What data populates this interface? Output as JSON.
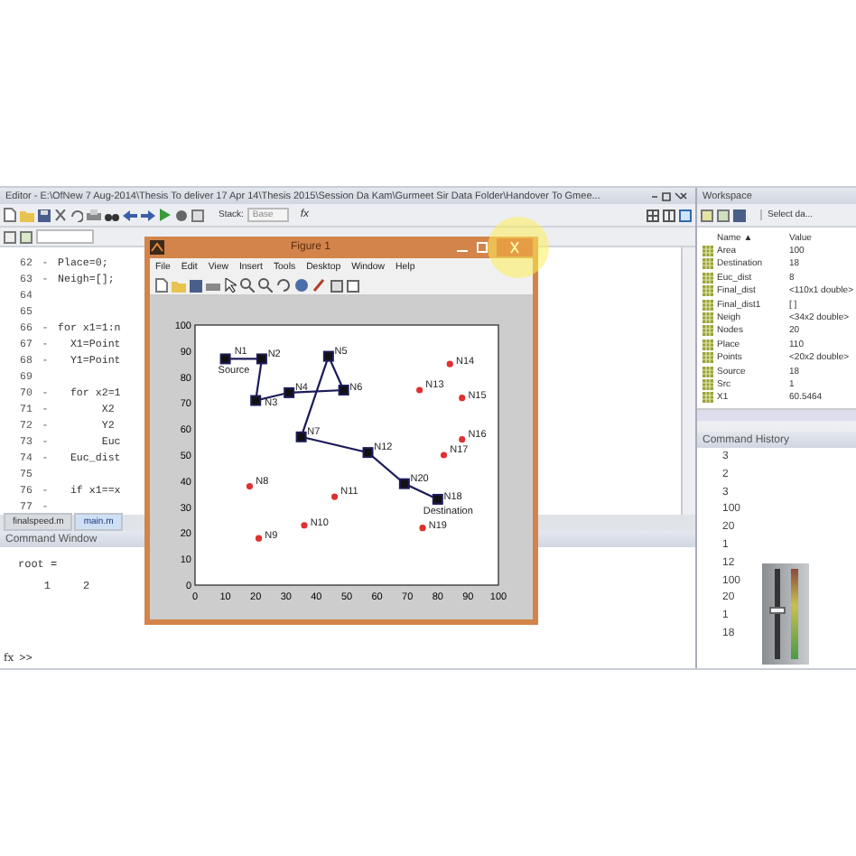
{
  "editor": {
    "title": "Editor - E:\\OfNew 7 Aug-2014\\Thesis To deliver 17 Apr 14\\Thesis 2015\\Session Da Kam\\Gurmeet Sir Data Folder\\Handover To Gmee...",
    "stack_label": "Stack:",
    "stack_value": "Base",
    "fx": "fx",
    "lines": [
      {
        "number": "62",
        "marker": "-",
        "code": "Place=0;"
      },
      {
        "number": "63",
        "marker": "-",
        "code": "Neigh=[];"
      },
      {
        "number": "64"
      },
      {
        "number": "65"
      },
      {
        "number": "66",
        "marker": "-",
        "code": "for x1=1:n"
      },
      {
        "number": "67",
        "marker": "-",
        "code": "  X1=Point"
      },
      {
        "number": "68",
        "marker": "-",
        "code": "  Y1=Point"
      },
      {
        "number": "69"
      },
      {
        "number": "70",
        "marker": "-",
        "code": "  for x2=1"
      },
      {
        "number": "71",
        "marker": "-",
        "code": "       X2"
      },
      {
        "number": "72",
        "marker": "-",
        "code": "       Y2"
      },
      {
        "number": "73",
        "marker": "-",
        "code": "       Euc"
      },
      {
        "number": "74",
        "marker": "-",
        "code": "  Euc_dist"
      },
      {
        "number": "75"
      },
      {
        "number": "76",
        "marker": "-",
        "code": "  if x1==x"
      },
      {
        "number": "77",
        "marker": "-"
      }
    ],
    "tabs": [
      {
        "label": "finalspeed.m",
        "selected": false
      },
      {
        "label": "main.m",
        "selected": true
      }
    ]
  },
  "command_window": {
    "title": "Command Window",
    "lines": [
      "root =",
      "    1     2"
    ],
    "function_label": "fx",
    "prompt": ">>"
  },
  "figure": {
    "title": "Figure 1",
    "menu": [
      "File",
      "Edit",
      "View",
      "Insert",
      "Tools",
      "Desktop",
      "Window",
      "Help"
    ],
    "chart_data": {
      "type": "line",
      "xlim": [
        0,
        100
      ],
      "ylim": [
        0,
        100
      ],
      "xticks": [
        0,
        10,
        20,
        30,
        40,
        50,
        60,
        70,
        80,
        90,
        100
      ],
      "yticks": [
        0,
        10,
        20,
        30,
        40,
        50,
        60,
        70,
        80,
        90,
        100
      ],
      "series": [
        {
          "type": "line",
          "marker": "square",
          "color": "#1c1c5a",
          "x": [
            10,
            22,
            20,
            31,
            49,
            44,
            35,
            57,
            69,
            80
          ],
          "values": [
            87,
            87,
            71,
            74,
            75,
            88,
            57,
            51,
            39,
            33
          ]
        },
        {
          "type": "scatter",
          "color": "#e03030",
          "x": [
            18,
            21,
            36,
            46,
            74,
            84,
            88,
            88,
            82,
            75
          ],
          "values": [
            38,
            18,
            23,
            34,
            75,
            85,
            72,
            56,
            50,
            22
          ]
        }
      ],
      "annotations": [
        {
          "x": 13,
          "y": 89,
          "text": "N1"
        },
        {
          "x": 24,
          "y": 88,
          "text": "N2"
        },
        {
          "x": 23,
          "y": 69,
          "text": "N3"
        },
        {
          "x": 33,
          "y": 75,
          "text": "N4"
        },
        {
          "x": 46,
          "y": 89,
          "text": "N5"
        },
        {
          "x": 51,
          "y": 75,
          "text": "N6"
        },
        {
          "x": 37,
          "y": 58,
          "text": "N7"
        },
        {
          "x": 20,
          "y": 39,
          "text": "N8"
        },
        {
          "x": 23,
          "y": 18,
          "text": "N9"
        },
        {
          "x": 38,
          "y": 23,
          "text": "N10"
        },
        {
          "x": 48,
          "y": 35,
          "text": "N11"
        },
        {
          "x": 59,
          "y": 52,
          "text": "N12"
        },
        {
          "x": 76,
          "y": 76,
          "text": "N13"
        },
        {
          "x": 86,
          "y": 85,
          "text": "N14"
        },
        {
          "x": 90,
          "y": 72,
          "text": "N15"
        },
        {
          "x": 90,
          "y": 57,
          "text": "N16"
        },
        {
          "x": 84,
          "y": 51,
          "text": "N17"
        },
        {
          "x": 82,
          "y": 33,
          "text": "N18"
        },
        {
          "x": 77,
          "y": 22,
          "text": "N19"
        },
        {
          "x": 71,
          "y": 40,
          "text": "N20"
        },
        "Source",
        "Destination"
      ]
    }
  },
  "workspace": {
    "title": "Workspace",
    "select": "Select da...",
    "columns": [
      "Name ▲",
      "Value"
    ],
    "rows": [
      {
        "name": "Area",
        "value": "100"
      },
      {
        "name": "Destination",
        "value": "18"
      },
      {
        "name": "Euc_dist",
        "value": "8"
      },
      {
        "name": "Final_dist",
        "value": "<110x1 double>"
      },
      {
        "name": "Final_dist1",
        "value": "[ ]"
      },
      {
        "name": "Neigh",
        "value": "<34x2 double>"
      },
      {
        "name": "Nodes",
        "value": "20"
      },
      {
        "name": "Place",
        "value": "110"
      },
      {
        "name": "Points",
        "value": "<20x2 double>"
      },
      {
        "name": "Source",
        "value": "18"
      },
      {
        "name": "Src",
        "value": "1"
      },
      {
        "name": "X1",
        "value": "60.5464"
      }
    ]
  },
  "command_history": {
    "title": "Command History",
    "entries": [
      "3",
      "2",
      "3",
      "100",
      "20",
      "1",
      "12",
      "100",
      "20",
      "1",
      "18"
    ]
  },
  "volume": {
    "level": 0.55
  }
}
